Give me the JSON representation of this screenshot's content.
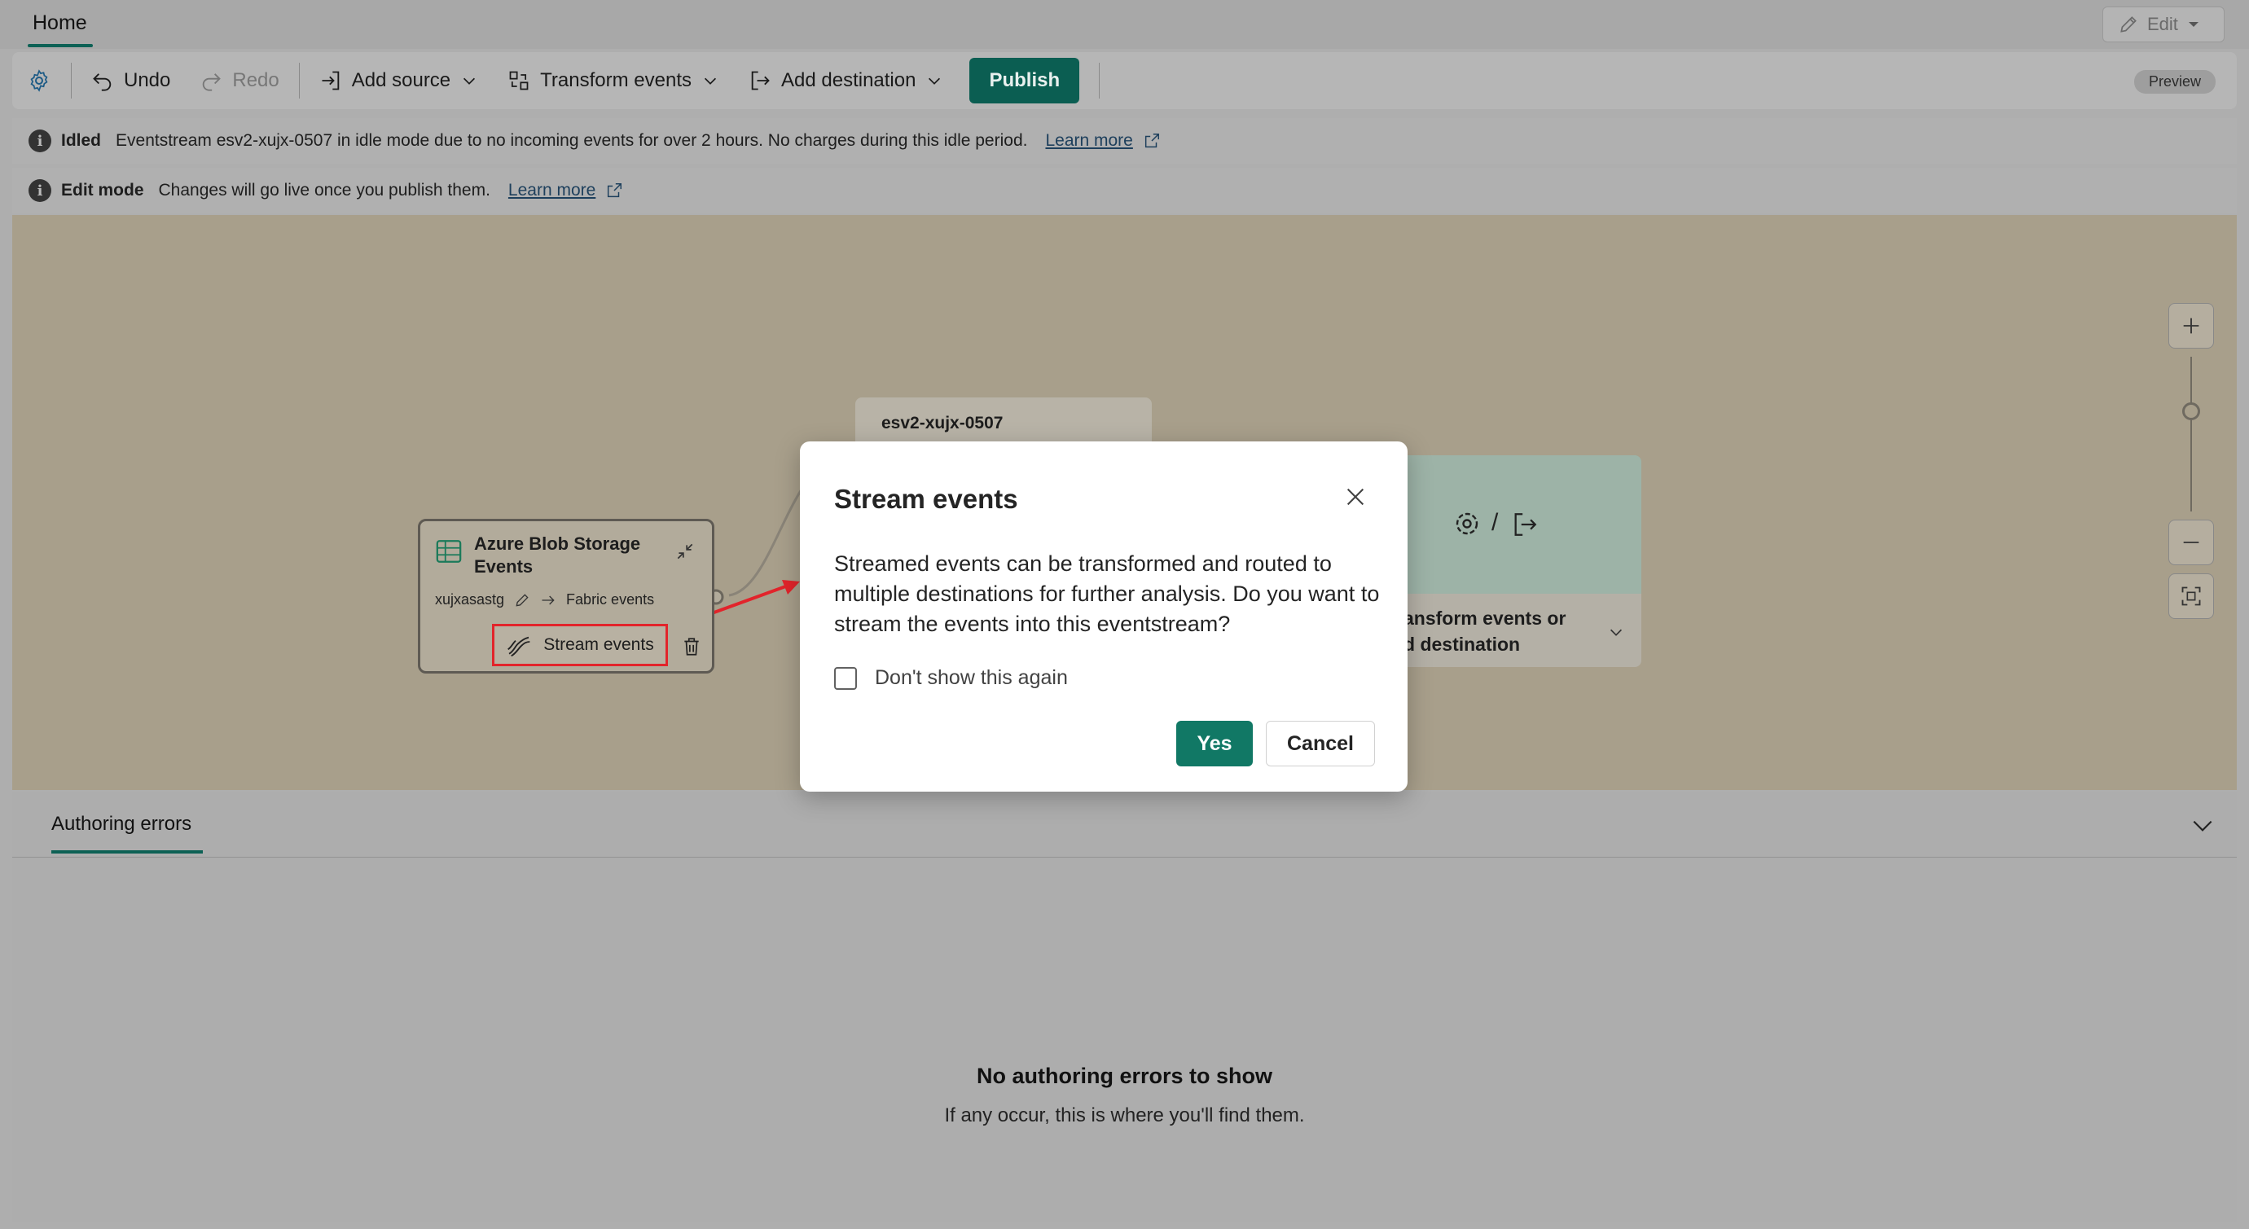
{
  "tabbar": {
    "home_label": "Home",
    "edit_label": "Edit"
  },
  "toolbar": {
    "undo_label": "Undo",
    "redo_label": "Redo",
    "add_source_label": "Add source",
    "transform_label": "Transform events",
    "add_destination_label": "Add destination",
    "publish_label": "Publish",
    "preview_label": "Preview"
  },
  "banners": {
    "idle": {
      "title": "Idled",
      "message": "Eventstream esv2-xujx-0507 in idle mode due to no incoming events for over 2 hours. No charges during this idle period.",
      "link": "Learn more"
    },
    "edit_mode": {
      "title": "Edit mode",
      "message": "Changes will go live once you publish them.",
      "link": "Learn more"
    }
  },
  "canvas": {
    "source_node": {
      "title": "Azure Blob Storage Events",
      "account": "xujxasastg",
      "target": "Fabric events",
      "stream_button": "Stream events"
    },
    "eventstream_node": {
      "title": "esv2-xujx-0507"
    },
    "destination_node": {
      "line1": "ansform events or",
      "line2": "d destination"
    }
  },
  "bottom_panel": {
    "tab_label": "Authoring errors",
    "empty_title": "No authoring errors to show",
    "empty_subtitle": "If any occur, this is where you'll find them."
  },
  "dialog": {
    "title": "Stream events",
    "body": "Streamed events can be transformed and routed to multiple destinations for further analysis. Do you want to stream the events into this eventstream?",
    "checkbox_label": "Don't show this again",
    "yes_label": "Yes",
    "cancel_label": "Cancel"
  },
  "colors": {
    "accent": "#117865",
    "highlight": "#e2242b",
    "overlay": "#a8a8a8"
  }
}
